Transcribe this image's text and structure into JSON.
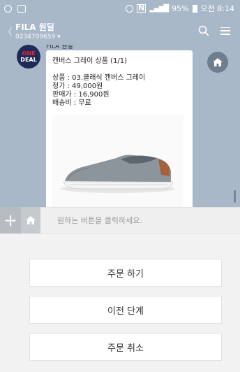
{
  "status": {
    "battery": "95%",
    "time": "오전 8:14"
  },
  "header": {
    "title": "FILA 원딜",
    "subtitle": "0234709659 ▾"
  },
  "chat": {
    "avatar_text": [
      "ONE",
      "DEAL"
    ],
    "sender": "FILA 원딜",
    "message": {
      "title": "캔버스 그레이 상품 (1/1)",
      "lines": [
        "상품 : 03.클래식 캔버스 그레이",
        "정가 :  49,000원",
        "판매가 :  16,900원",
        "배송비 : 무료"
      ]
    }
  },
  "input": {
    "placeholder": "원하는 버튼을 클릭하세요."
  },
  "buttons": [
    "주문 하기",
    "이전 단계",
    "주문 취소"
  ],
  "colors": {
    "header_bg": "#a9b8c9",
    "avatar_bg": "#1f2b56",
    "shoe": "#8b959b",
    "accent": "#e0263d"
  }
}
